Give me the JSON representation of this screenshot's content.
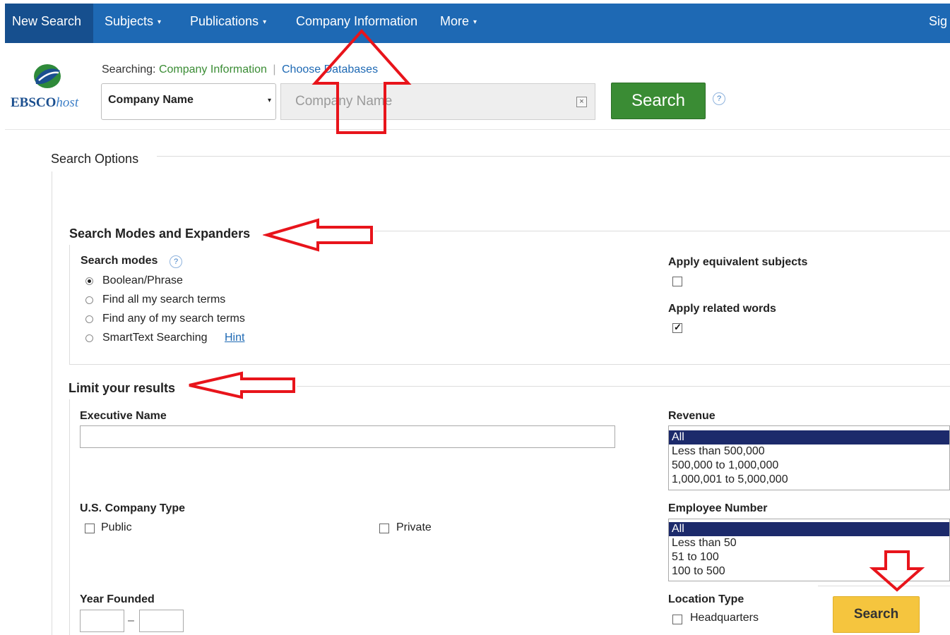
{
  "nav": {
    "new_search": "New Search",
    "subjects": "Subjects",
    "publications": "Publications",
    "company_information": "Company Information",
    "more": "More",
    "sign_in": "Sig",
    "caret": "▾"
  },
  "brand": {
    "name_bold": "EBSCO",
    "name_italic": "host",
    "accent_color": "#1e69b4"
  },
  "searching": {
    "prefix": "Searching:",
    "database": "Company Information",
    "separator": "|",
    "choose_databases": "Choose Databases"
  },
  "search_bar": {
    "field_select": "Company Name",
    "input_placeholder": "Company Name",
    "clear": "×",
    "search_button": "Search",
    "search_button_color": "#3a8c34",
    "help": "?"
  },
  "search_options": {
    "title": "Search Options",
    "modes_section": {
      "title": "Search Modes and Expanders",
      "modes_label": "Search modes",
      "modes": [
        {
          "label": "Boolean/Phrase",
          "selected": true
        },
        {
          "label": "Find all my search terms",
          "selected": false
        },
        {
          "label": "Find any of my search terms",
          "selected": false
        },
        {
          "label": "SmartText Searching",
          "selected": false
        }
      ],
      "hint": "Hint",
      "apply_equivalent_subjects": {
        "label": "Apply equivalent subjects",
        "checked": false
      },
      "apply_related_words": {
        "label": "Apply related words",
        "checked": true
      }
    },
    "limit_section": {
      "title": "Limit your results",
      "executive_name": {
        "label": "Executive Name",
        "value": ""
      },
      "revenue": {
        "label": "Revenue",
        "options": [
          "All",
          "Less than 500,000",
          "500,000 to 1,000,000",
          "1,000,001 to 5,000,000"
        ],
        "selected": "All"
      },
      "company_type": {
        "label": "U.S. Company Type",
        "public": {
          "label": "Public",
          "checked": false
        },
        "private": {
          "label": "Private",
          "checked": false
        }
      },
      "employee_number": {
        "label": "Employee Number",
        "options": [
          "All",
          "Less than 50",
          "51 to 100",
          "100 to 500"
        ],
        "selected": "All"
      },
      "year_founded": {
        "label": "Year Founded",
        "from": "",
        "to": "",
        "separator": "–"
      },
      "location_type": {
        "label": "Location Type",
        "headquarters": {
          "label": "Headquarters",
          "checked": false
        }
      }
    },
    "bottom_search_button": "Search",
    "bottom_search_color": "#f5c53e"
  },
  "annotation_color": "#e8141b"
}
